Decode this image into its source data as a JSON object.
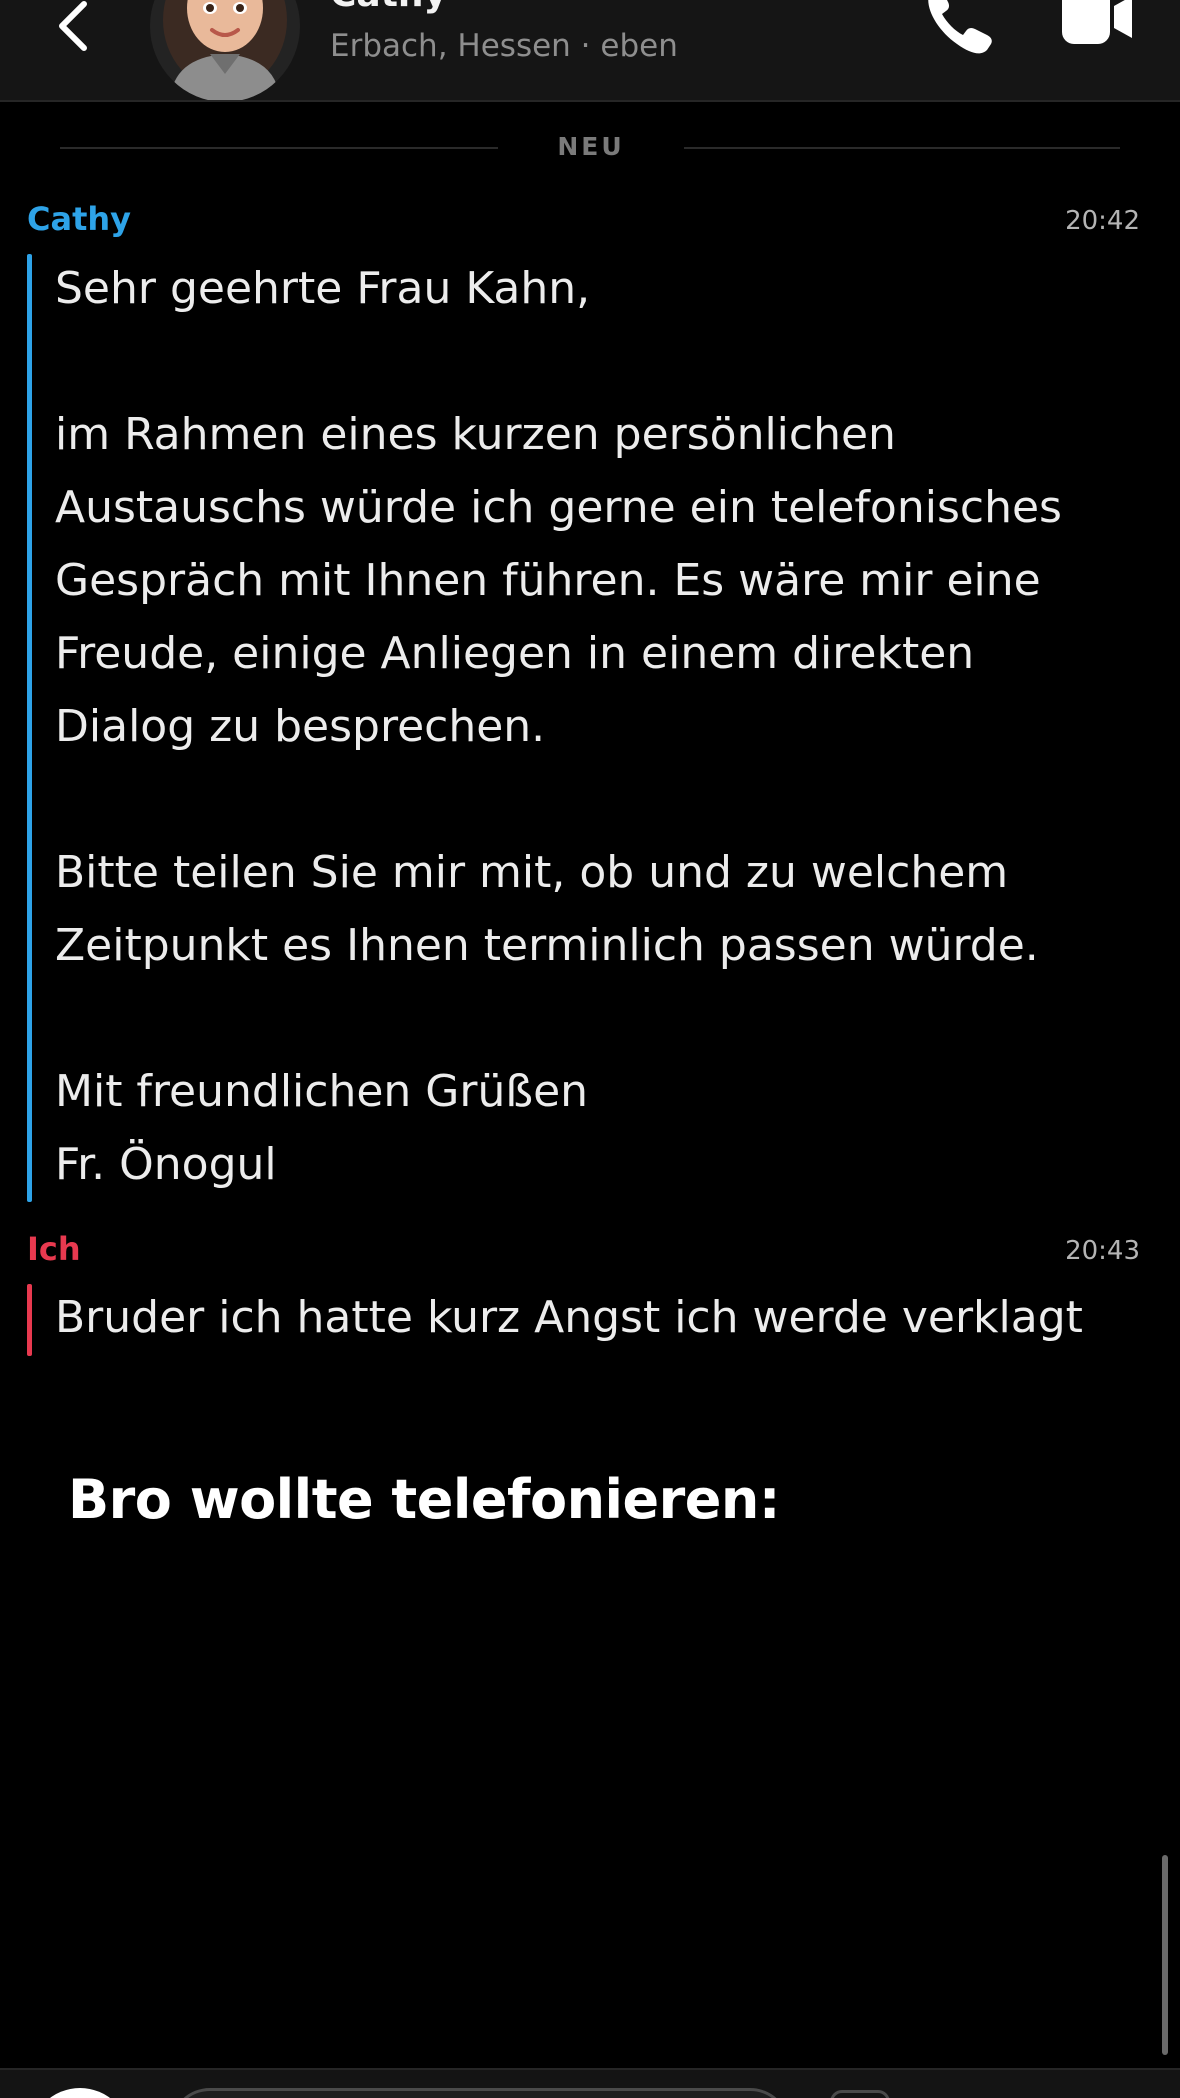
{
  "header": {
    "contact_name": "Cathy",
    "status": "Erbach, Hessen · eben",
    "back_icon": "chevron-left-icon",
    "call_icon": "phone-icon",
    "video_icon": "video-camera-icon"
  },
  "divider": {
    "label": "NEU"
  },
  "messages": [
    {
      "sender": "Cathy",
      "time": "20:42",
      "color": "#2ea3e8",
      "lines": [
        "Sehr geehrte Frau Kahn,",
        "",
        "im Rahmen eines kurzen persönlichen",
        "Austauschs würde ich gerne ein telefonisches",
        "Gespräch mit Ihnen führen. Es wäre mir eine",
        "Freude, einige Anliegen in einem direkten",
        "Dialog zu besprechen.",
        "",
        "Bitte teilen Sie mir mit, ob und zu welchem",
        "Zeitpunkt es Ihnen terminlich passen würde.",
        "",
        "Mit freundlichen Grüßen",
        "Fr. Önogul"
      ]
    },
    {
      "sender": "Ich",
      "time": "20:43",
      "color": "#e8394f",
      "lines": [
        "Bruder ich hatte kurz Angst ich werde verklagt"
      ]
    }
  ],
  "caption": "Bro wollte telefonieren:",
  "colors": {
    "background": "#000000",
    "header": "#151515",
    "cathy": "#2ea3e8",
    "me": "#e8394f"
  }
}
